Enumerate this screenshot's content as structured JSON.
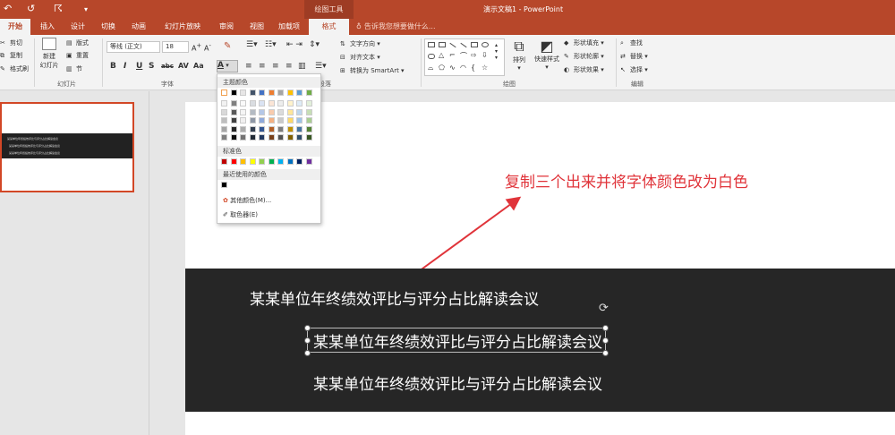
{
  "titlebar": {
    "qat_undo": "↶",
    "qat_redo": "↺",
    "qat_from_start": "☈",
    "qat_more": "▾",
    "drawing_tools": "绘图工具",
    "doc_title": "演示文稿1 - PowerPoint"
  },
  "tabs": [
    {
      "label": "开始",
      "active": true
    },
    {
      "label": "插入"
    },
    {
      "label": "设计"
    },
    {
      "label": "切换"
    },
    {
      "label": "动画"
    },
    {
      "label": "幻灯片放映"
    },
    {
      "label": "审阅"
    },
    {
      "label": "视图"
    },
    {
      "label": "加载项"
    },
    {
      "label": "格式"
    }
  ],
  "tellme": "告诉我您想要做什么...",
  "ribbon": {
    "clipboard": {
      "cut": "剪切",
      "copy": "复制",
      "painter": "格式刷"
    },
    "slides": {
      "new_slide_1": "新建",
      "new_slide_2": "幻灯片",
      "layout": "版式",
      "reset": "重置",
      "section": "节",
      "group": "幻灯片"
    },
    "font": {
      "font_name": "等线 (正文)",
      "font_size": "18",
      "group": "字体"
    },
    "paragraph": {
      "text_direction": "文字方向",
      "align_text": "对齐文本",
      "smartart": "转换为 SmartArt",
      "group": "段落"
    },
    "drawing": {
      "arrange": "排列",
      "quick_styles": "快速样式",
      "fill": "形状填充",
      "outline": "形状轮廓",
      "effects": "形状效果",
      "group": "绘图"
    },
    "editing": {
      "find": "查找",
      "replace": "替换",
      "select": "选择",
      "group": "编辑"
    }
  },
  "color_picker": {
    "theme_header": "主题颜色",
    "standard_header": "标准色",
    "recent_header": "最近使用的颜色",
    "more_colors": "其他颜色(M)...",
    "eyedropper": "取色器(E)",
    "theme_top": [
      "#ffffff",
      "#000000",
      "#e7e6e6",
      "#44546a",
      "#4472c4",
      "#ed7d31",
      "#a5a5a5",
      "#ffc000",
      "#5b9bd5",
      "#70ad47"
    ],
    "standard": [
      "#c00000",
      "#ff0000",
      "#ffc000",
      "#ffff00",
      "#92d050",
      "#00b050",
      "#00b0f0",
      "#0070c0",
      "#002060",
      "#7030a0"
    ],
    "recent": [
      "#000000"
    ]
  },
  "thumbnail": {
    "lines": [
      "某某单位年终绩效评比与评分占比解读会议",
      "某某单位年终绩效评比与评分占比解读会议",
      "某某单位年终绩效评比与评分占比解读会议"
    ]
  },
  "slide": {
    "annotation": "复制三个出来并将字体颜色改为白色",
    "line1": "某某单位年终绩效评比与评分占比解读会议",
    "line2": "某某单位年终绩效评比与评分占比解读会议",
    "line3": "某某单位年终绩效评比与评分占比解读会议"
  },
  "colors": {
    "accent": "#b7472a",
    "annotation_red": "#e0343a",
    "band": "#262626"
  }
}
